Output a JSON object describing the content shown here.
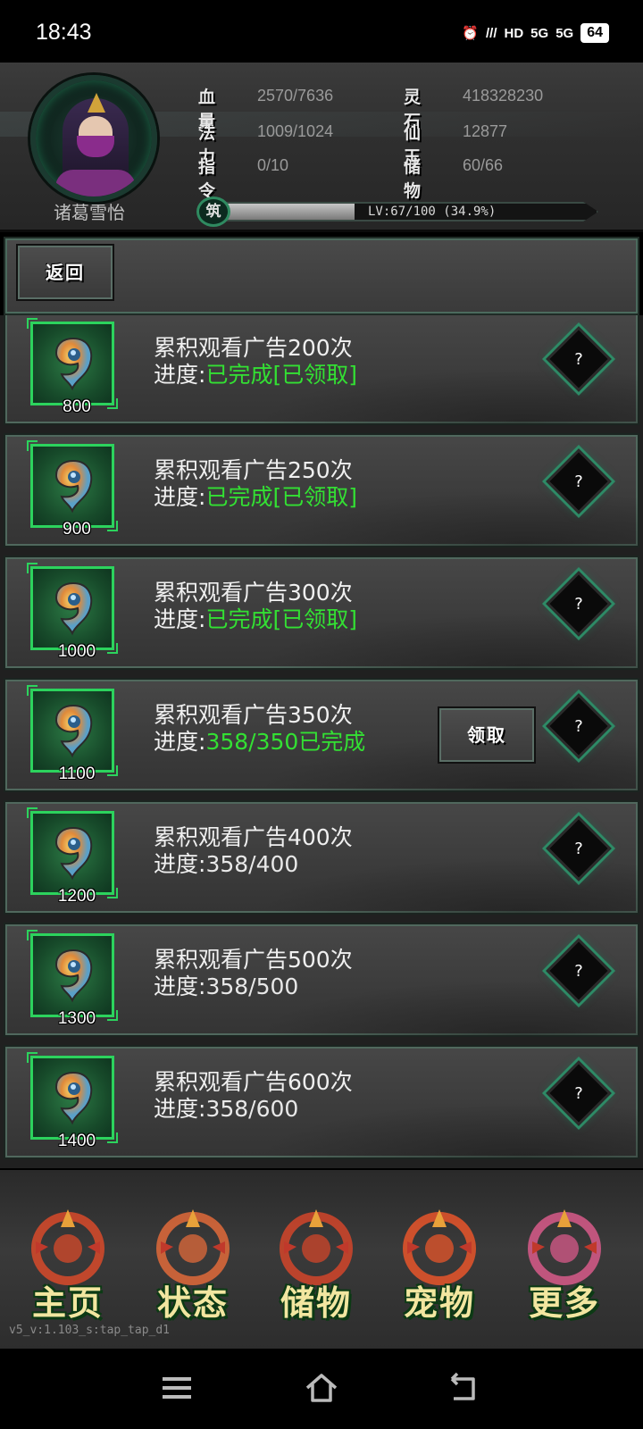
{
  "status_bar": {
    "time": "18:43",
    "battery": "64",
    "signal_labels": [
      "5G",
      "5G"
    ]
  },
  "player": {
    "name": "诸葛雪怡",
    "stats": [
      {
        "label": "血量",
        "value": "2570/7636"
      },
      {
        "label": "灵石",
        "value": "418328230"
      },
      {
        "label": "法力",
        "value": "1009/1024"
      },
      {
        "label": "仙玉",
        "value": "12877"
      },
      {
        "label": "指令",
        "value": "0/10"
      },
      {
        "label": "储物",
        "value": "60/66"
      }
    ],
    "exp_badge": "筑",
    "exp_text": "LV:67/100 (34.9%)",
    "exp_fraction": 0.349
  },
  "back_label": "返回",
  "claim_label": "领取",
  "help_label": "?",
  "progress_prefix": "进度:",
  "tasks": [
    {
      "title": "累积观看广告200次",
      "reward": "800",
      "progress": "已完成[已领取]",
      "done": true,
      "claimable": false
    },
    {
      "title": "累积观看广告250次",
      "reward": "900",
      "progress": "已完成[已领取]",
      "done": true,
      "claimable": false
    },
    {
      "title": "累积观看广告300次",
      "reward": "1000",
      "progress": "已完成[已领取]",
      "done": true,
      "claimable": false
    },
    {
      "title": "累积观看广告350次",
      "reward": "1100",
      "progress": "358/350已完成",
      "done": true,
      "claimable": true
    },
    {
      "title": "累积观看广告400次",
      "reward": "1200",
      "progress": "358/400",
      "done": false,
      "claimable": false
    },
    {
      "title": "累积观看广告500次",
      "reward": "1300",
      "progress": "358/500",
      "done": false,
      "claimable": false
    },
    {
      "title": "累积观看广告600次",
      "reward": "1400",
      "progress": "358/600",
      "done": false,
      "claimable": false
    }
  ],
  "nav": [
    {
      "label": "主页",
      "icon": "home-emblem-icon",
      "color": "#d84a2a"
    },
    {
      "label": "状态",
      "icon": "status-emblem-icon",
      "color": "#e06a3a"
    },
    {
      "label": "储物",
      "icon": "storage-emblem-icon",
      "color": "#d2452a"
    },
    {
      "label": "宠物",
      "icon": "pet-phoenix-icon",
      "color": "#e8552a"
    },
    {
      "label": "更多",
      "icon": "more-emblem-icon",
      "color": "#d85a8a"
    }
  ],
  "version": "v5_v:1.103_s:tap_tap_d1",
  "colors": {
    "done_green": "#33e033",
    "frame_green": "#2cd35d"
  }
}
